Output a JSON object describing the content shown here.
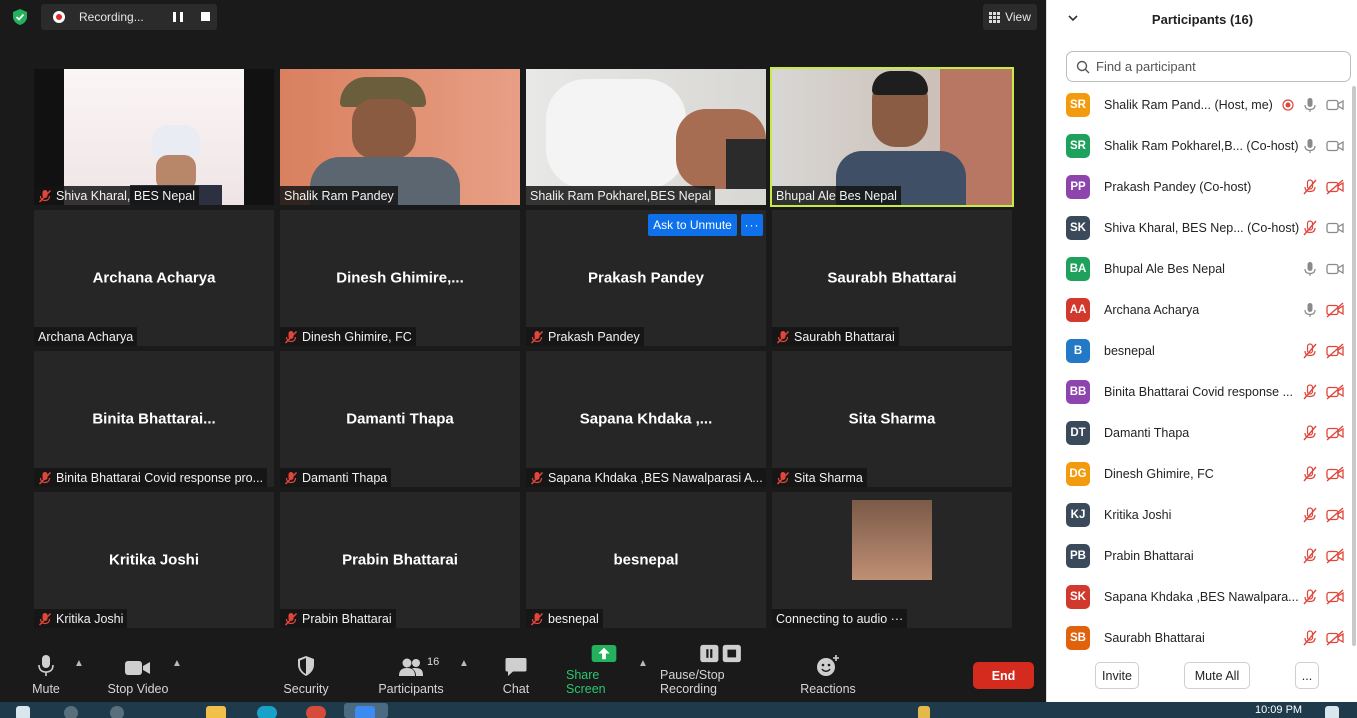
{
  "recording": {
    "label": "Recording..."
  },
  "view": {
    "label": "View"
  },
  "tiles": [
    {
      "label": "Shiva Kharal, BES Nepal",
      "video": true,
      "muted": true
    },
    {
      "label": "Shalik Ram Pandey",
      "video": true,
      "muted": false
    },
    {
      "label": "Shalik Ram Pokharel,BES Nepal",
      "video": true,
      "muted": false
    },
    {
      "label": "Bhupal Ale Bes Nepal",
      "video": true,
      "muted": false,
      "active": true
    },
    {
      "name": "Archana Acharya",
      "label": "Archana Acharya",
      "muted": false
    },
    {
      "name": "Dinesh  Ghimire,...",
      "label": "Dinesh Ghimire, FC",
      "muted": true
    },
    {
      "name": "Prakash Pandey",
      "label": "Prakash Pandey",
      "muted": true
    },
    {
      "name": "Saurabh Bhattarai",
      "label": "Saurabh Bhattarai",
      "muted": true
    },
    {
      "name": "Binita  Bhattarai...",
      "label": "Binita Bhattarai Covid response pro...",
      "muted": true
    },
    {
      "name": "Damanti Thapa",
      "label": "Damanti Thapa",
      "muted": true
    },
    {
      "name": "Sapana  Khdaka ,...",
      "label": "Sapana Khdaka ,BES Nawalparasi A...",
      "muted": true
    },
    {
      "name": "Sita Sharma",
      "label": "Sita Sharma",
      "muted": true
    },
    {
      "name": "Kritika Joshi",
      "label": "Kritika Joshi",
      "muted": true
    },
    {
      "name": "Prabin Bhattarai",
      "label": "Prabin Bhattarai",
      "muted": true
    },
    {
      "name": "besnepal",
      "label": "besnepal",
      "muted": true
    },
    {
      "label": "Connecting to audio ···",
      "video": true,
      "muted": false
    }
  ],
  "hover": {
    "ask_unmute": "Ask to Unmute",
    "more": "···"
  },
  "toolbar": {
    "mute": "Mute",
    "stop_video": "Stop Video",
    "security": "Security",
    "participants": "Participants",
    "participants_count": "16",
    "chat": "Chat",
    "share_screen": "Share Screen",
    "pause_stop_recording": "Pause/Stop Recording",
    "reactions": "Reactions",
    "end": "End"
  },
  "panel": {
    "title": "Participants (16)",
    "search_placeholder": "Find a participant",
    "participants": [
      {
        "initials": "SR",
        "name": "Shalik Ram Pand...  (Host, me)",
        "color": "#f29b0f",
        "mic": "on",
        "video": "on",
        "rec": true
      },
      {
        "initials": "SR",
        "name": "Shalik Ram Pokharel,B...  (Co-host)",
        "color": "#1fa15e",
        "mic": "on",
        "video": "on"
      },
      {
        "initials": "PP",
        "name": "Prakash Pandey (Co-host)",
        "color": "#8e44ad",
        "mic": "off",
        "video": "off"
      },
      {
        "initials": "SK",
        "name": "Shiva Kharal, BES Nep...  (Co-host)",
        "color": "#3b4a5a",
        "mic": "off",
        "video": "on"
      },
      {
        "initials": "BA",
        "name": "Bhupal Ale Bes Nepal",
        "color": "#1fa15e",
        "mic": "on",
        "video": "on"
      },
      {
        "initials": "AA",
        "name": "Archana Acharya",
        "color": "#d0392b",
        "mic": "on",
        "video": "off"
      },
      {
        "initials": "B",
        "name": "besnepal",
        "color": "#2479c7",
        "mic": "off",
        "video": "off"
      },
      {
        "initials": "BB",
        "name": "Binita Bhattarai Covid response ...",
        "color": "#8e44ad",
        "mic": "off",
        "video": "off"
      },
      {
        "initials": "DT",
        "name": "Damanti Thapa",
        "color": "#3b4a5a",
        "mic": "off",
        "video": "off"
      },
      {
        "initials": "DG",
        "name": "Dinesh Ghimire, FC",
        "color": "#f29b0f",
        "mic": "off",
        "video": "off"
      },
      {
        "initials": "KJ",
        "name": "Kritika Joshi",
        "color": "#3b4a5a",
        "mic": "off",
        "video": "off"
      },
      {
        "initials": "PB",
        "name": "Prabin Bhattarai",
        "color": "#3b4a5a",
        "mic": "off",
        "video": "off"
      },
      {
        "initials": "SK",
        "name": "Sapana Khdaka ,BES Nawalpara...",
        "color": "#d0392b",
        "mic": "off",
        "video": "off"
      },
      {
        "initials": "SB",
        "name": "Saurabh Bhattarai",
        "color": "#e0620d",
        "mic": "off",
        "video": "off"
      }
    ],
    "invite": "Invite",
    "mute_all": "Mute All",
    "more": "..."
  },
  "taskbar": {
    "time": "10:09 PM"
  }
}
